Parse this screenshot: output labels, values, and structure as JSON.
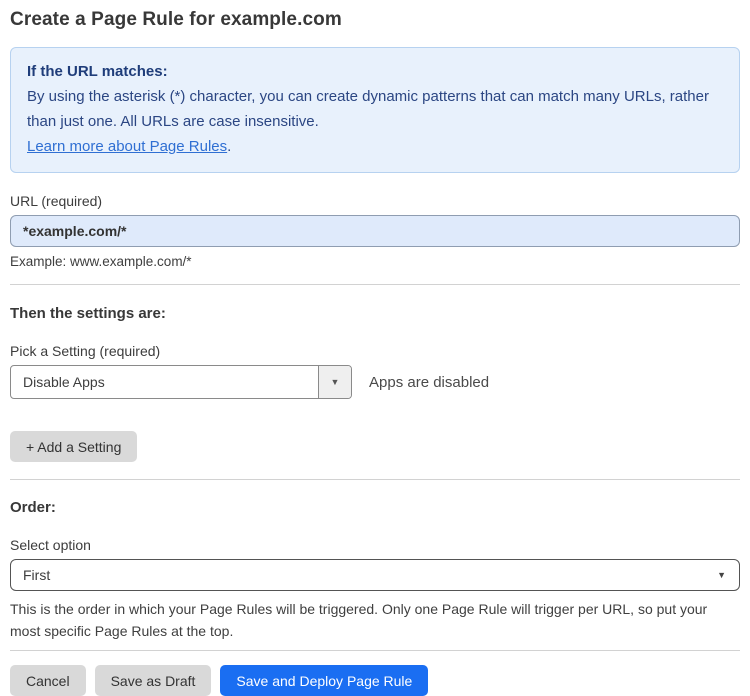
{
  "page": {
    "title": "Create a Page Rule for example.com"
  },
  "info_box": {
    "heading": "If the URL matches:",
    "body": "By using the asterisk (*) character, you can create dynamic patterns that can match many URLs, rather than just one. All URLs are case insensitive.",
    "link_label": "Learn more about Page Rules",
    "link_suffix": "."
  },
  "url_field": {
    "label": "URL (required)",
    "value": "*example.com/*",
    "example": "Example: www.example.com/*"
  },
  "settings_section": {
    "heading": "Then the settings are:",
    "picker_label": "Pick a Setting (required)",
    "selected_setting": "Disable Apps",
    "status_text": "Apps are disabled",
    "add_setting_label": "+ Add a Setting"
  },
  "order_section": {
    "heading": "Order:",
    "select_label": "Select option",
    "selected_option": "First",
    "help_text": "This is the order in which your Page Rules will be triggered. Only one Page Rule will trigger per URL, so put your most specific Page Rules at the top."
  },
  "footer": {
    "cancel_label": "Cancel",
    "save_draft_label": "Save as Draft",
    "save_deploy_label": "Save and Deploy Page Rule"
  },
  "icons": {
    "dropdown_arrow": "▼"
  },
  "colors": {
    "info_box_bg": "#e8f1fc",
    "info_box_border": "#b7d2f0",
    "info_heading_text": "#1f3d7a",
    "info_body_text": "#2b4683",
    "link_blue": "#2f6fd3",
    "input_bg": "#dfeafb",
    "primary_button_blue": "#1a6ef2",
    "gray_button_bg": "#d9d9d9"
  }
}
